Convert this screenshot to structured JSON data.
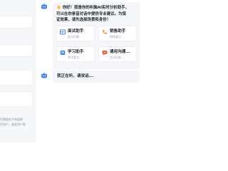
{
  "background_panel": {
    "snippet_line1": "们例假在不知道患",
    "snippet_line2": "们用户，真实用户呢"
  },
  "assistant": {
    "icon": "bot-icon",
    "greeting_line1": "👋 你好！我是你的听脑AI实时分析助手，",
    "greeting_line2": "可以在你录音对话中提供专业建议。为保",
    "greeting_line3": "证效果，请先选择场景和身份！",
    "scenario_cards": [
      {
        "title": "面试助手",
        "subtitle": "面试问题...",
        "icon": "interview-icon",
        "color": "#3b7cf6"
      },
      {
        "title": "销售助手",
        "subtitle": "销售要点...",
        "icon": "sales-phone-icon",
        "color": "#f28a2e"
      },
      {
        "title": "学习助手",
        "subtitle": "考试要点...",
        "icon": "study-icon",
        "color": "#3b7cf6"
      },
      {
        "title": "通用沟通...",
        "subtitle": "会议纪要...",
        "icon": "chat-icon",
        "color": "#f25a3a"
      }
    ],
    "reply": "我正在听，请说话..."
  },
  "colors": {
    "accent": "#3b7cf6",
    "bubble": "#f4f6f9"
  }
}
